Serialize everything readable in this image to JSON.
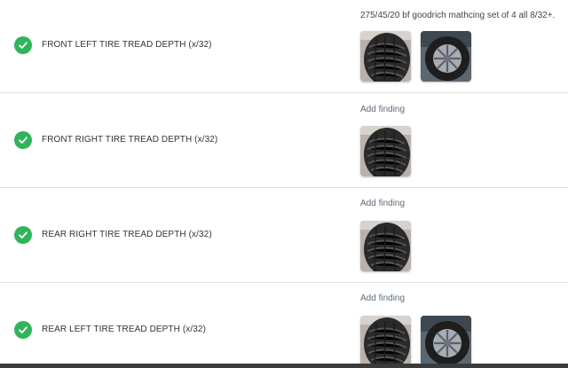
{
  "colors": {
    "check_green": "#2fb45a",
    "divider": "#e2e2e2",
    "add_finding": "#5f6b78"
  },
  "icons": {
    "check": "check-circle-icon"
  },
  "rows": [
    {
      "label": "FRONT LEFT TIRE TREAD DEPTH (x/32)",
      "finding": "275/45/20 bf goodrich mathcing set of 4 all 8/32+.",
      "add_finding": "",
      "photo_count": 2
    },
    {
      "label": "FRONT RIGHT TIRE TREAD DEPTH (x/32)",
      "finding": "",
      "add_finding": "Add finding",
      "photo_count": 1
    },
    {
      "label": "REAR RIGHT TIRE TREAD DEPTH (x/32)",
      "finding": "",
      "add_finding": "Add finding",
      "photo_count": 1
    },
    {
      "label": "REAR LEFT TIRE TREAD DEPTH (x/32)",
      "finding": "",
      "add_finding": "Add finding",
      "photo_count": 2
    }
  ]
}
